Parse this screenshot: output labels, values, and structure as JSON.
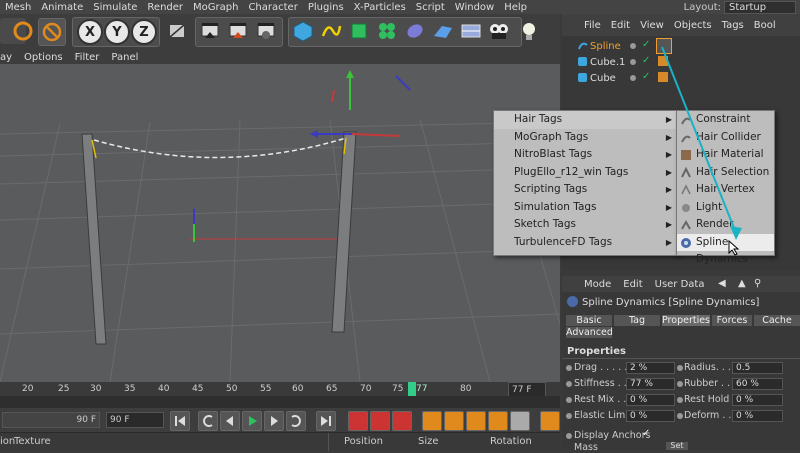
{
  "menubar": {
    "items": [
      "Mesh",
      "Animate",
      "Simulate",
      "Render",
      "MoGraph",
      "Character",
      "Plugins",
      "X-Particles",
      "Script",
      "Window",
      "Help"
    ],
    "layout_label": "Layout:",
    "layout_value": "Startup"
  },
  "toolbar": {
    "axis_x": "X",
    "axis_y": "Y",
    "axis_z": "Z"
  },
  "viewport_menu": {
    "items": [
      "ay",
      "Options",
      "Filter",
      "Panel"
    ]
  },
  "timeline": {
    "ticks": [
      "20",
      "25",
      "30",
      "35",
      "40",
      "45",
      "50",
      "55",
      "60",
      "65",
      "70",
      "75",
      "77",
      "80"
    ],
    "current_frame": "77",
    "end_frame": "77 F",
    "min_field": "90 F",
    "max_field": "90 F"
  },
  "bottom_bar": {
    "left_labels": [
      "ion",
      "Texture"
    ],
    "position": "Position",
    "size": "Size",
    "rotation": "Rotation"
  },
  "object_manager": {
    "menu": [
      "File",
      "Edit",
      "View",
      "Objects",
      "Tags",
      "Bool"
    ],
    "objects": [
      {
        "name": "Spline"
      },
      {
        "name": "Cube.1"
      },
      {
        "name": "Cube"
      }
    ]
  },
  "context_menu": {
    "items": [
      {
        "label": "Hair Tags",
        "selected": true
      },
      {
        "label": "MoGraph Tags"
      },
      {
        "label": "NitroBlast Tags"
      },
      {
        "label": "PlugEllo_r12_win Tags"
      },
      {
        "label": "Scripting Tags"
      },
      {
        "label": "Simulation Tags"
      },
      {
        "label": "Sketch Tags"
      },
      {
        "label": "TurbulenceFD Tags"
      }
    ]
  },
  "submenu": {
    "items": [
      {
        "label": "Constraint"
      },
      {
        "label": "Hair Collider"
      },
      {
        "label": "Hair Material"
      },
      {
        "label": "Hair Selection"
      },
      {
        "label": "Hair Vertex"
      },
      {
        "label": "Light"
      },
      {
        "label": "Render"
      },
      {
        "label": "Spline Dynamics",
        "selected": true
      }
    ]
  },
  "attribute_manager": {
    "menu": [
      "Mode",
      "Edit",
      "User Data"
    ],
    "title": "Spline Dynamics [Spline Dynamics]",
    "tabs": [
      "Basic",
      "Tag",
      "Properties",
      "Forces",
      "Cache"
    ],
    "tab_advanced": "Advanced",
    "section": "Properties",
    "left_props": [
      {
        "label": "Drag . . . . . . .",
        "value": "2 %"
      },
      {
        "label": "Stiffness . . .",
        "value": "77 %"
      },
      {
        "label": "Rest Mix . . .",
        "value": "0 %"
      },
      {
        "label": "Elastic Limit",
        "value": "0 %"
      }
    ],
    "right_props": [
      {
        "label": "Radius. . . . .",
        "value": "0.5"
      },
      {
        "label": "Rubber . . .",
        "value": "60 %"
      },
      {
        "label": "Rest Hold",
        "value": "0 %"
      },
      {
        "label": "Deform . . .",
        "value": "0 %"
      }
    ],
    "display_anchors": "Display Anchors",
    "checkmark": "✓",
    "mass_label": "Mass",
    "set_button": "Set"
  }
}
